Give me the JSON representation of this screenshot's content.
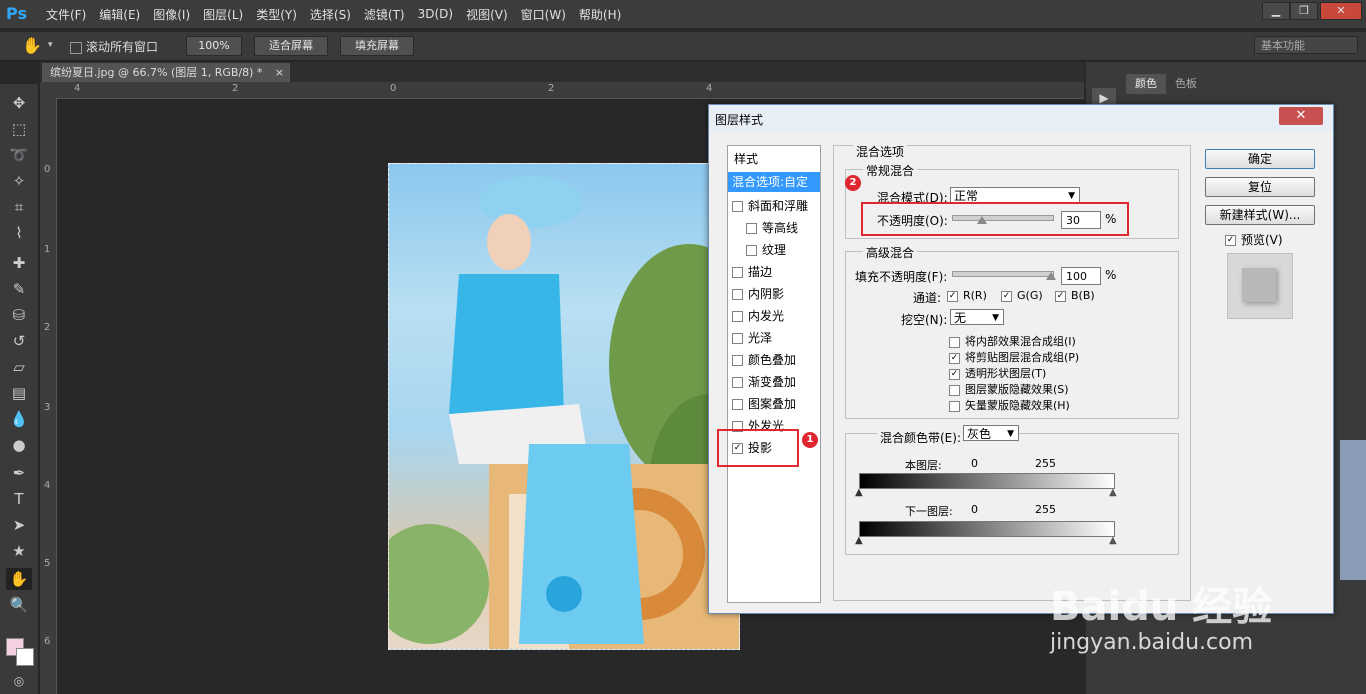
{
  "app": {
    "logo": "Ps"
  },
  "menu": [
    "文件(F)",
    "编辑(E)",
    "图像(I)",
    "图层(L)",
    "类型(Y)",
    "选择(S)",
    "滤镜(T)",
    "3D(D)",
    "视图(V)",
    "窗口(W)",
    "帮助(H)"
  ],
  "window_buttons": {
    "minimize": "▁",
    "restore": "❐",
    "close": "✕"
  },
  "options_bar": {
    "scroll_all_label": "滚动所有窗口",
    "zoom_100": "100%",
    "fit_screen": "适合屏幕",
    "fill_screen": "填充屏幕",
    "workspace": "基本功能"
  },
  "document_tab": {
    "title": "缤纷夏日.jpg @ 66.7% (图层 1, RGB/8) *",
    "close": "×"
  },
  "ruler_h_ticks": [
    "4",
    "2",
    "0",
    "2",
    "4"
  ],
  "ruler_v_ticks": [
    "0",
    "1",
    "2",
    "3",
    "4",
    "5",
    "6"
  ],
  "right_panel": {
    "tab_color": "颜色",
    "tab_swatches": "色板"
  },
  "dialog": {
    "title": "图层样式",
    "close": "✕",
    "styles_header": "样式",
    "styles": [
      {
        "label": "混合选项:自定",
        "selected": true,
        "checkbox": false,
        "checked": false
      },
      {
        "label": "斜面和浮雕",
        "checkbox": true,
        "checked": false
      },
      {
        "label": "等高线",
        "checkbox": true,
        "checked": false,
        "indent": true
      },
      {
        "label": "纹理",
        "checkbox": true,
        "checked": false,
        "indent": true
      },
      {
        "label": "描边",
        "checkbox": true,
        "checked": false
      },
      {
        "label": "内阴影",
        "checkbox": true,
        "checked": false
      },
      {
        "label": "内发光",
        "checkbox": true,
        "checked": false
      },
      {
        "label": "光泽",
        "checkbox": true,
        "checked": false
      },
      {
        "label": "颜色叠加",
        "checkbox": true,
        "checked": false
      },
      {
        "label": "渐变叠加",
        "checkbox": true,
        "checked": false
      },
      {
        "label": "图案叠加",
        "checkbox": true,
        "checked": false
      },
      {
        "label": "外发光",
        "checkbox": true,
        "checked": false
      },
      {
        "label": "投影",
        "checkbox": true,
        "checked": true
      }
    ],
    "blend_options_title": "混合选项",
    "general_blend": {
      "title": "常规混合",
      "mode_label": "混合模式(D):",
      "mode_value": "正常",
      "opacity_label": "不透明度(O):",
      "opacity_value": "30",
      "opacity_unit": "%"
    },
    "advanced_blend": {
      "title": "高级混合",
      "fill_label": "填充不透明度(F):",
      "fill_value": "100",
      "fill_unit": "%",
      "channels_label": "通道:",
      "channels": [
        {
          "label": "R(R)",
          "checked": true
        },
        {
          "label": "G(G)",
          "checked": true
        },
        {
          "label": "B(B)",
          "checked": true
        }
      ],
      "knockout_label": "挖空(N):",
      "knockout_value": "无",
      "options": [
        {
          "label": "将内部效果混合成组(I)",
          "checked": false
        },
        {
          "label": "将剪贴图层混合成组(P)",
          "checked": true
        },
        {
          "label": "透明形状图层(T)",
          "checked": true
        },
        {
          "label": "图层蒙版隐藏效果(S)",
          "checked": false
        },
        {
          "label": "矢量蒙版隐藏效果(H)",
          "checked": false
        }
      ]
    },
    "blend_if": {
      "label": "混合颜色带(E):",
      "value": "灰色",
      "this_layer": "本图层:",
      "this_low": "0",
      "this_high": "255",
      "under_layer": "下一图层:",
      "under_low": "0",
      "under_high": "255"
    },
    "buttons": {
      "ok": "确定",
      "reset": "复位",
      "new_style": "新建样式(W)...",
      "preview_label": "预览(V)",
      "preview_checked": true
    },
    "annotations": {
      "badge1": "1",
      "badge2": "2"
    }
  },
  "watermark": {
    "brand": "Baidu 经验",
    "url": "jingyan.baidu.com"
  }
}
